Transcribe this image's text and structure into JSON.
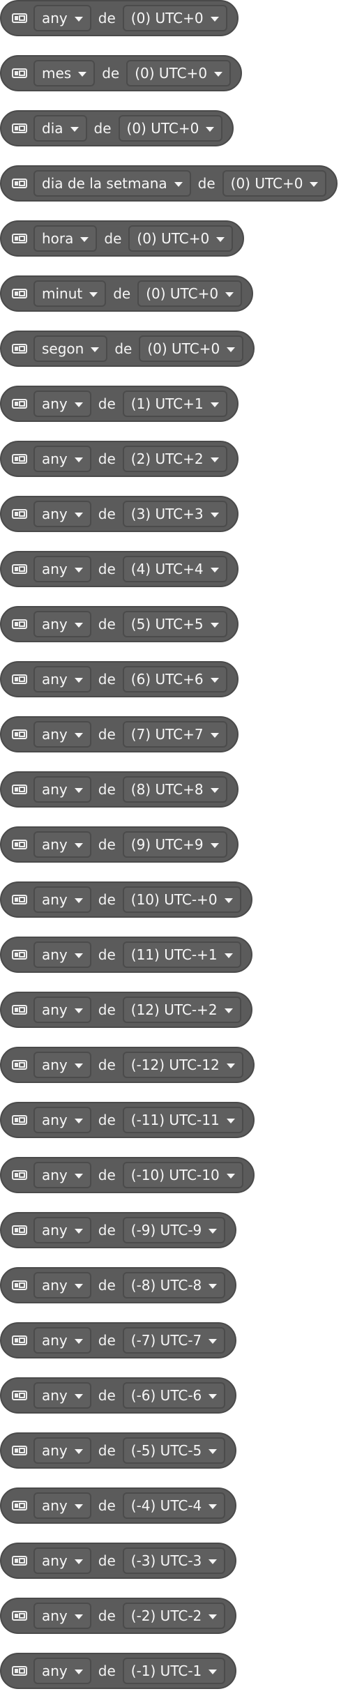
{
  "blocks": [
    {
      "unit": "any",
      "sep": "de",
      "tz": "(0) UTC+0"
    },
    {
      "unit": "mes",
      "sep": "de",
      "tz": "(0) UTC+0"
    },
    {
      "unit": "dia",
      "sep": "de",
      "tz": "(0) UTC+0"
    },
    {
      "unit": "dia de la setmana",
      "sep": "de",
      "tz": "(0) UTC+0"
    },
    {
      "unit": "hora",
      "sep": "de",
      "tz": "(0) UTC+0"
    },
    {
      "unit": "minut",
      "sep": "de",
      "tz": "(0) UTC+0"
    },
    {
      "unit": "segon",
      "sep": "de",
      "tz": "(0) UTC+0"
    },
    {
      "unit": "any",
      "sep": "de",
      "tz": "(1) UTC+1"
    },
    {
      "unit": "any",
      "sep": "de",
      "tz": "(2) UTC+2"
    },
    {
      "unit": "any",
      "sep": "de",
      "tz": "(3) UTC+3"
    },
    {
      "unit": "any",
      "sep": "de",
      "tz": "(4) UTC+4"
    },
    {
      "unit": "any",
      "sep": "de",
      "tz": "(5) UTC+5"
    },
    {
      "unit": "any",
      "sep": "de",
      "tz": "(6) UTC+6"
    },
    {
      "unit": "any",
      "sep": "de",
      "tz": "(7) UTC+7"
    },
    {
      "unit": "any",
      "sep": "de",
      "tz": "(8) UTC+8"
    },
    {
      "unit": "any",
      "sep": "de",
      "tz": "(9) UTC+9"
    },
    {
      "unit": "any",
      "sep": "de",
      "tz": "(10) UTC-+0"
    },
    {
      "unit": "any",
      "sep": "de",
      "tz": "(11) UTC-+1"
    },
    {
      "unit": "any",
      "sep": "de",
      "tz": "(12) UTC-+2"
    },
    {
      "unit": "any",
      "sep": "de",
      "tz": "(-12) UTC-12"
    },
    {
      "unit": "any",
      "sep": "de",
      "tz": "(-11) UTC-11"
    },
    {
      "unit": "any",
      "sep": "de",
      "tz": "(-10) UTC-10"
    },
    {
      "unit": "any",
      "sep": "de",
      "tz": "(-9) UTC-9"
    },
    {
      "unit": "any",
      "sep": "de",
      "tz": "(-8) UTC-8"
    },
    {
      "unit": "any",
      "sep": "de",
      "tz": "(-7) UTC-7"
    },
    {
      "unit": "any",
      "sep": "de",
      "tz": "(-6) UTC-6"
    },
    {
      "unit": "any",
      "sep": "de",
      "tz": "(-5) UTC-5"
    },
    {
      "unit": "any",
      "sep": "de",
      "tz": "(-4) UTC-4"
    },
    {
      "unit": "any",
      "sep": "de",
      "tz": "(-3) UTC-3"
    },
    {
      "unit": "any",
      "sep": "de",
      "tz": "(-2) UTC-2"
    },
    {
      "unit": "any",
      "sep": "de",
      "tz": "(-1) UTC-1"
    }
  ],
  "icons": {
    "block_icon": "calendar-icon",
    "dropdown_arrow": "chevron-down-icon"
  },
  "colors": {
    "block_bg": "#5b5b5b",
    "block_border": "#4a4a4a",
    "dropdown_bg": "#5f5f5f",
    "dropdown_border": "#4b4b4b",
    "text": "#f2f2f2"
  }
}
